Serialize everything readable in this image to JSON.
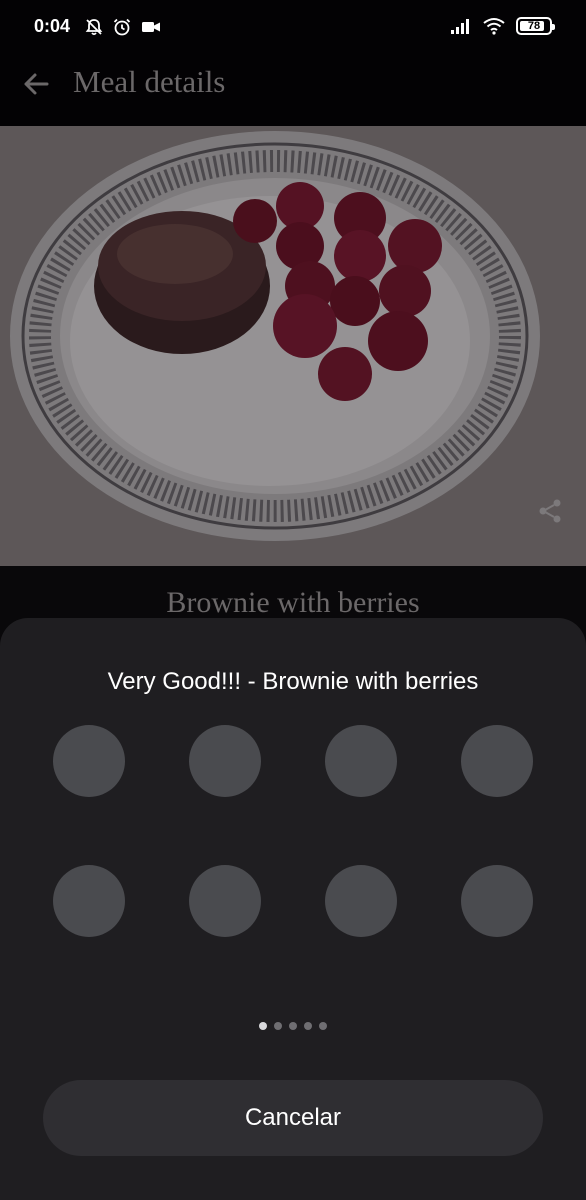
{
  "status_bar": {
    "time": "0:04",
    "battery_level": "78",
    "icons_left": [
      "bell-off-icon",
      "alarm-icon",
      "video-camera-icon"
    ],
    "icons_right": [
      "signal-icon",
      "wifi-icon",
      "battery-icon"
    ]
  },
  "app_bar": {
    "title": "Meal details",
    "back_icon": "arrow-left-icon"
  },
  "photo": {
    "actions": [
      "share-icon",
      "edit-icon",
      "delete-icon"
    ]
  },
  "meal": {
    "name": "Brownie with berries"
  },
  "share_sheet": {
    "title": "Very Good!!! - Brownie with berries",
    "target_count": 8,
    "pages": 5,
    "current_page": 1,
    "cancel_label": "Cancelar"
  },
  "colors": {
    "background": "#030204",
    "sheet": "#1f1e21",
    "target_circle": "#4a4b4f",
    "muted_text": "#6b6869"
  }
}
